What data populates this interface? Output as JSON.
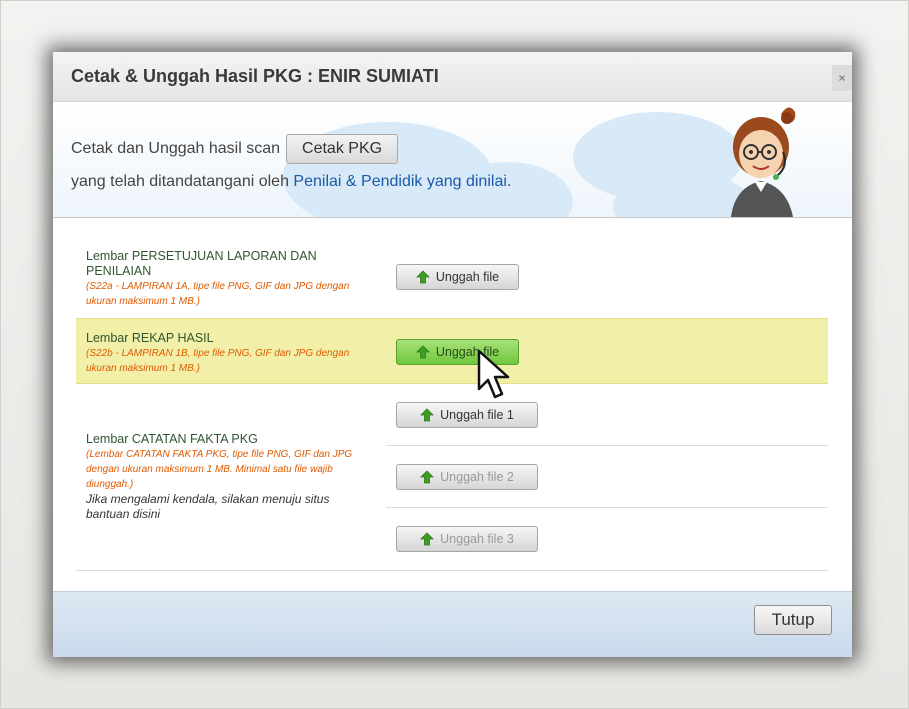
{
  "dialog": {
    "title": "Cetak & Unggah Hasil PKG : ENIR SUMIATI",
    "close_icon": "×"
  },
  "header": {
    "line1_text": "Cetak dan Unggah hasil scan",
    "cetak_button": "Cetak PKG",
    "line2_text": "yang telah ditandatangani oleh",
    "line2_link": "Penilai & Pendidik yang dinilai",
    "line2_end": "."
  },
  "rows": {
    "persetujuan": {
      "label_line1": "Lembar PERSETUJUAN LAPORAN DAN",
      "label_line2": "PENILAIAN",
      "note_line1": "(S22a - LAMPIRAN 1A, tipe file PNG, GIF dan JPG dengan",
      "note_line2": "ukuran maksimum 1 MB.)",
      "button": "Unggah file"
    },
    "rekap": {
      "label": "Lembar REKAP HASIL",
      "note_line1": "(S22b - LAMPIRAN 1B, tipe file PNG, GIF dan JPG dengan",
      "note_line2": "ukuran maksimum 1 MB.)",
      "button": "Unggah file"
    },
    "catatan": {
      "label": "Lembar CATATAN FAKTA PKG",
      "note_line1": "(Lembar CATATAN FAKTA PKG, tipe file PNG, GIF dan JPG",
      "note_line2": "dengan ukuran maksimum 1 MB. Minimal satu file wajib",
      "note_line3": "diunggah.)",
      "help_line1": "Jika mengalami kendala, silakan menuju situs",
      "help_line2": "bantuan disini",
      "button1": "Unggah file 1",
      "button2": "Unggah file 2",
      "button3": "Unggah file 3"
    }
  },
  "footer": {
    "tutup_button": "Tutup"
  },
  "icons": {
    "upload": "upload-arrow-icon",
    "close": "close-icon",
    "mascot": "operator-mascot",
    "cursor": "mouse-cursor"
  },
  "colors": {
    "highlight_row": "#f2f0a8",
    "upload_arrow": "#3f9c24",
    "note_text": "#e05a00",
    "link": "#1a5aa6"
  }
}
